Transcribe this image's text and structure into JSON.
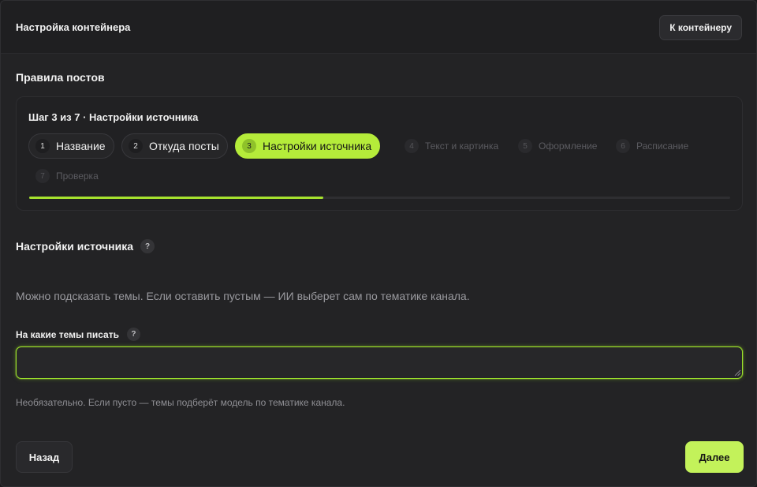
{
  "header": {
    "title": "Настройка контейнера",
    "to_container_label": "К контейнеру"
  },
  "section_title": "Правила постов",
  "stepper": {
    "caption": "Шаг 3 из 7 · Настройки источника",
    "current_step": 3,
    "total_steps": 7,
    "progress_fraction": 0.42,
    "steps": [
      {
        "num": "1",
        "label": "Название",
        "state": "done"
      },
      {
        "num": "2",
        "label": "Откуда посты",
        "state": "done"
      },
      {
        "num": "3",
        "label": "Настройки источника",
        "state": "active"
      },
      {
        "num": "4",
        "label": "Текст и картинка",
        "state": "todo"
      },
      {
        "num": "5",
        "label": "Оформление",
        "state": "todo"
      },
      {
        "num": "6",
        "label": "Расписание",
        "state": "todo"
      },
      {
        "num": "7",
        "label": "Проверка",
        "state": "todo"
      }
    ]
  },
  "source_settings": {
    "title": "Настройки источника",
    "help_glyph": "?",
    "hint": "Можно подсказать темы. Если оставить пустым — ИИ выберет сам по тематике канала.",
    "topics_label": "На какие темы писать",
    "topics_value": "",
    "topics_help": "Необязательно. Если пусто — темы подберёт модель по тематике канала."
  },
  "footer": {
    "back_label": "Назад",
    "next_label": "Далее"
  },
  "colors": {
    "accent": "#b5ec3a",
    "next_button": "#c3f25a",
    "background": "#232325"
  }
}
